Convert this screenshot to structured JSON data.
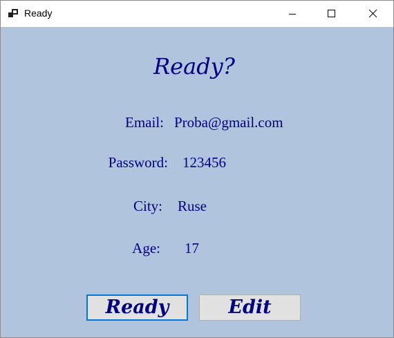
{
  "window": {
    "title": "Ready",
    "icon": "app-form-icon",
    "controls": [
      "minimize-icon",
      "maximize-icon",
      "close-icon"
    ],
    "background_color": "#b0c4de"
  },
  "heading": "Ready?",
  "fields": {
    "email": {
      "label": "Email:",
      "value": "Proba@gmail.com"
    },
    "password": {
      "label": "Password:",
      "value": "123456"
    },
    "city": {
      "label": "City:",
      "value": "Ruse"
    },
    "age": {
      "label": "Age:",
      "value": "17"
    }
  },
  "buttons": {
    "ready": "Ready",
    "edit": "Edit"
  },
  "colors": {
    "text": "#000080",
    "focus_border": "#0078d7",
    "button_face": "#e1e1e1"
  }
}
